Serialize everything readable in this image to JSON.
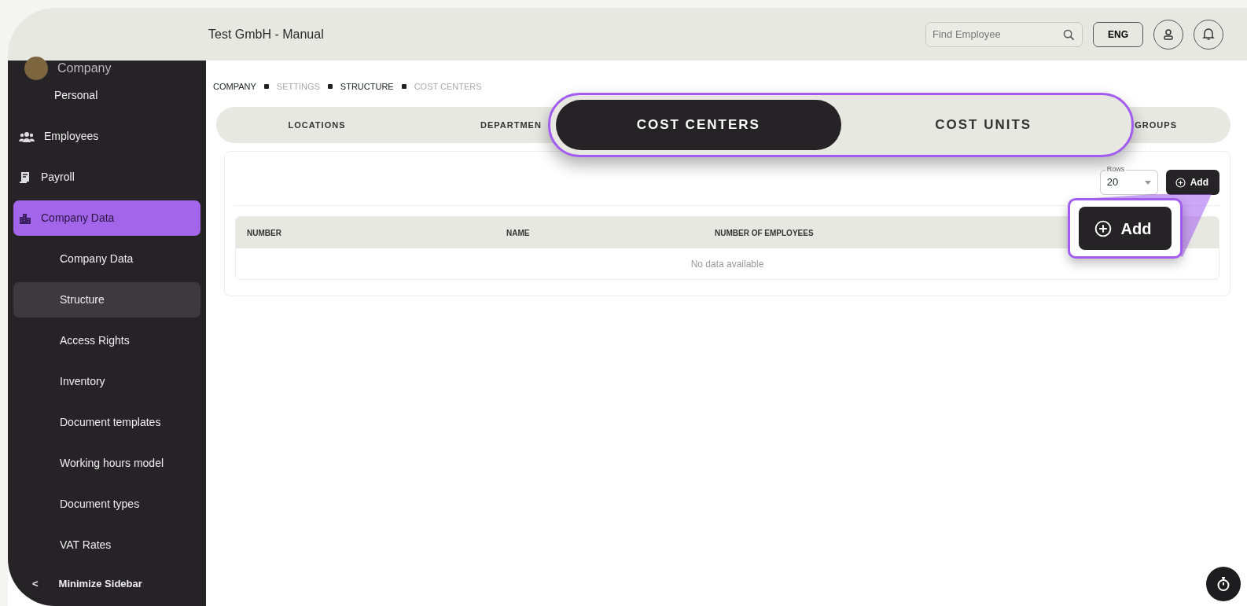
{
  "header": {
    "title": "Test GmbH - Manual",
    "search": {
      "placeholder": "Find Employee"
    },
    "language": "ENG"
  },
  "sidebar": {
    "company": {
      "label": "Company",
      "children": [
        {
          "label": "Personal",
          "selected": false
        }
      ]
    },
    "items": [
      {
        "label": "Employees",
        "selected": false
      },
      {
        "label": "Payroll",
        "selected": false
      },
      {
        "label": "Company Data",
        "selected": true,
        "children": [
          {
            "label": "Company Data",
            "selected": false
          },
          {
            "label": "Structure",
            "selected": true
          },
          {
            "label": "Access Rights",
            "selected": false
          },
          {
            "label": "Inventory",
            "selected": false
          },
          {
            "label": "Document templates",
            "selected": false
          },
          {
            "label": "Working hours model",
            "selected": false
          },
          {
            "label": "Document types",
            "selected": false
          },
          {
            "label": "VAT Rates",
            "selected": false
          }
        ]
      }
    ],
    "minimize": "Minimize Sidebar",
    "minimize_arrow": "<"
  },
  "breadcrumb": [
    {
      "label": "COMPANY",
      "muted": false
    },
    {
      "label": "SETTINGS",
      "muted": true
    },
    {
      "label": "STRUCTURE",
      "muted": false
    },
    {
      "label": "COST CENTERS",
      "muted": true
    }
  ],
  "tabs": [
    {
      "label": "LOCATIONS",
      "selected": false
    },
    {
      "label": "DEPARTMEN",
      "selected": false
    },
    {
      "label": "GROUPS",
      "selected": false
    }
  ],
  "tabs_callout": [
    {
      "label": "COST CENTERS",
      "selected": true
    },
    {
      "label": "COST UNITS",
      "selected": false
    }
  ],
  "toolbar": {
    "rows_label": "Rows",
    "rows_value": "20",
    "add": "Add"
  },
  "add_callout": "Add",
  "table": {
    "columns": [
      "NUMBER",
      "NAME",
      "NUMBER OF EMPLOYEES"
    ],
    "empty": "No data available"
  }
}
